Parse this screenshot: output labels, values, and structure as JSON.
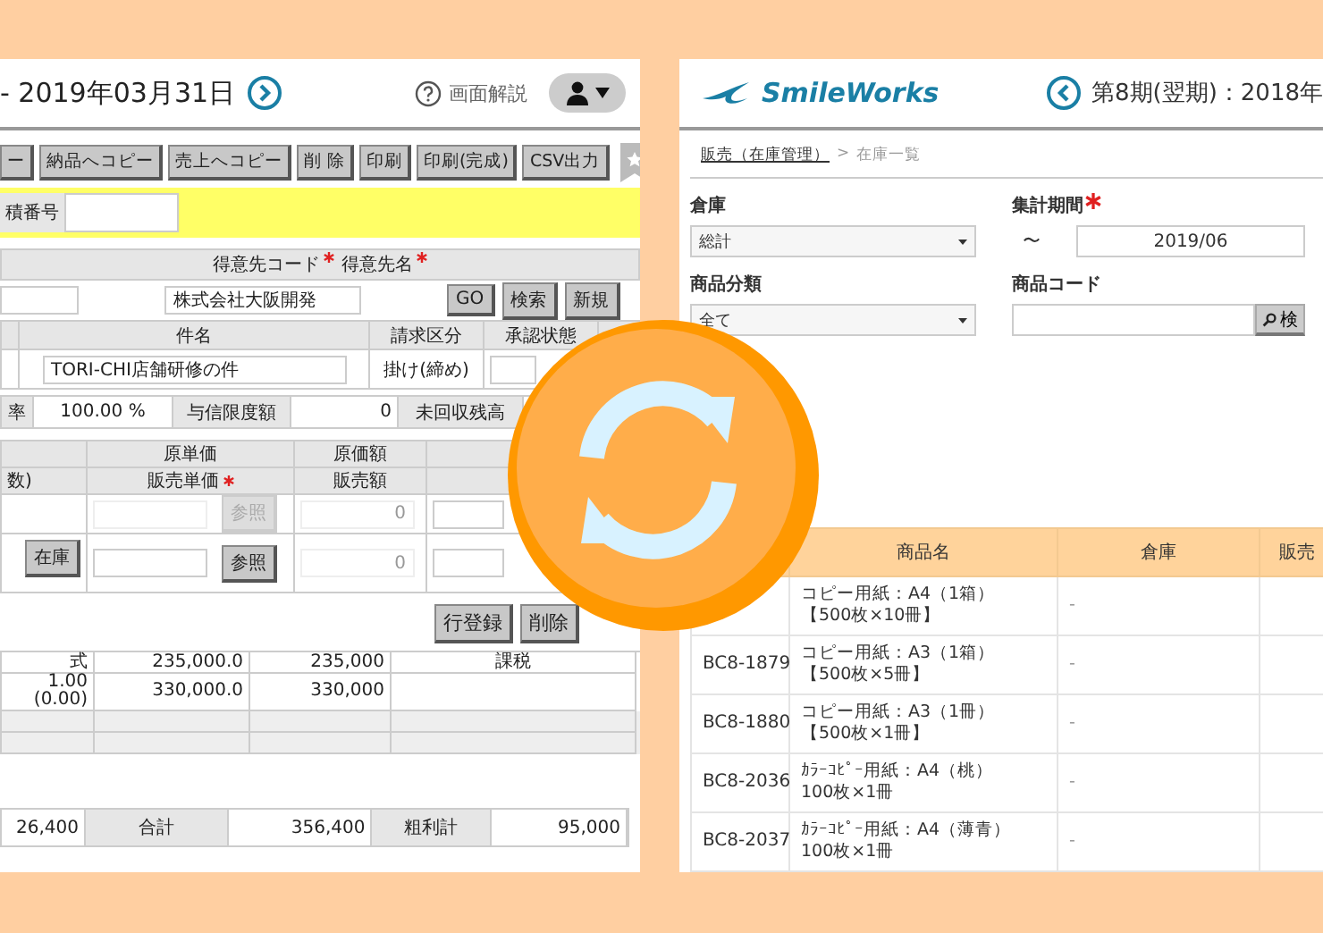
{
  "left": {
    "title": "- 2019年03月31日",
    "help": "画面解説",
    "toolbar": [
      "ー",
      "納品へコピー",
      "売上へコピー",
      "削 除",
      "印刷",
      "印刷(完成)",
      "CSV出力"
    ],
    "estimate": {
      "label": "積番号"
    },
    "customer": {
      "labels": [
        {
          "text": "得意先コード",
          "required": true
        },
        {
          "text": "得意先名",
          "required": true
        }
      ],
      "name": "株式会社大阪開発",
      "buttons": [
        "GO",
        "検索",
        "新規"
      ]
    },
    "subject": {
      "headers": [
        "件名",
        "請求区分",
        "承認状態"
      ],
      "title": "TORI-CHI店舗研修の件",
      "billing": "掛け(締め)"
    },
    "credit": [
      "率",
      "100.00 %",
      "与信限度額",
      "0",
      "未回収残高"
    ],
    "detail": {
      "headers_top": [
        "原単価",
        "原価額"
      ],
      "headers_bottom": [
        {
          "text": "数)",
          "required": false
        },
        {
          "text": "販売単価",
          "required": true
        },
        {
          "text": "販売額",
          "required": false
        }
      ],
      "rows": [
        {
          "ref": "参照",
          "disabled": true,
          "amount": "0"
        },
        {
          "stock": "在庫",
          "ref": "参照",
          "disabled": false,
          "amount": "0"
        }
      ]
    },
    "row_buttons": [
      "行登録",
      "削除"
    ],
    "lines": [
      {
        "kind": "item",
        "qty": "式",
        "price": "235,000.0",
        "amount": "235,000",
        "tax": "課税"
      },
      {
        "kind": "item",
        "qty": "1.00\n(0.00)",
        "price": "330,000.0",
        "amount": "330,000"
      },
      {
        "kind": "blank"
      },
      {
        "kind": "blank"
      }
    ],
    "totals": [
      "26,400",
      "合計",
      "356,400",
      "粗利計",
      "95,000"
    ]
  },
  "right": {
    "logo": "SmileWorks",
    "period": "第8期(翌期)：2018年",
    "breadcrumb": {
      "link": "販売（在庫管理）",
      "separator": ">",
      "current": "在庫一覧"
    },
    "fields": [
      {
        "label": "倉庫",
        "kind": "select",
        "value": "総計",
        "required": false
      },
      {
        "label": "集計期間",
        "kind": "period",
        "prefix": "〜",
        "value": "2019/06",
        "required": true
      },
      {
        "label": "商品分類",
        "kind": "select",
        "value": "全て",
        "required": false
      },
      {
        "label": "商品コード",
        "kind": "search",
        "button": "検",
        "required": false
      }
    ],
    "table": {
      "columns": [
        "商品名",
        "倉庫",
        "販売"
      ],
      "rows": [
        {
          "name": [
            "コピー用紙：A4（1箱）",
            "【500枚×10冊】"
          ],
          "warehouse": "-"
        },
        {
          "code": "BC8-1879",
          "name": [
            "コピー用紙：A3（1箱）",
            "【500枚×5冊】"
          ],
          "warehouse": "-"
        },
        {
          "code": "BC8-1880",
          "name": [
            "コピー用紙：A3（1冊）",
            "【500枚×1冊】"
          ],
          "warehouse": "-"
        },
        {
          "code": "BC8-2036",
          "name": [
            "ｶﾗｰｺﾋﾟｰ用紙：A4（桃）",
            "100枚×1冊"
          ],
          "warehouse": "-"
        },
        {
          "code": "BC8-2037",
          "name": [
            "ｶﾗｰｺﾋﾟｰ用紙：A4（薄青）",
            "100枚×1冊"
          ],
          "warehouse": "-"
        }
      ]
    }
  }
}
